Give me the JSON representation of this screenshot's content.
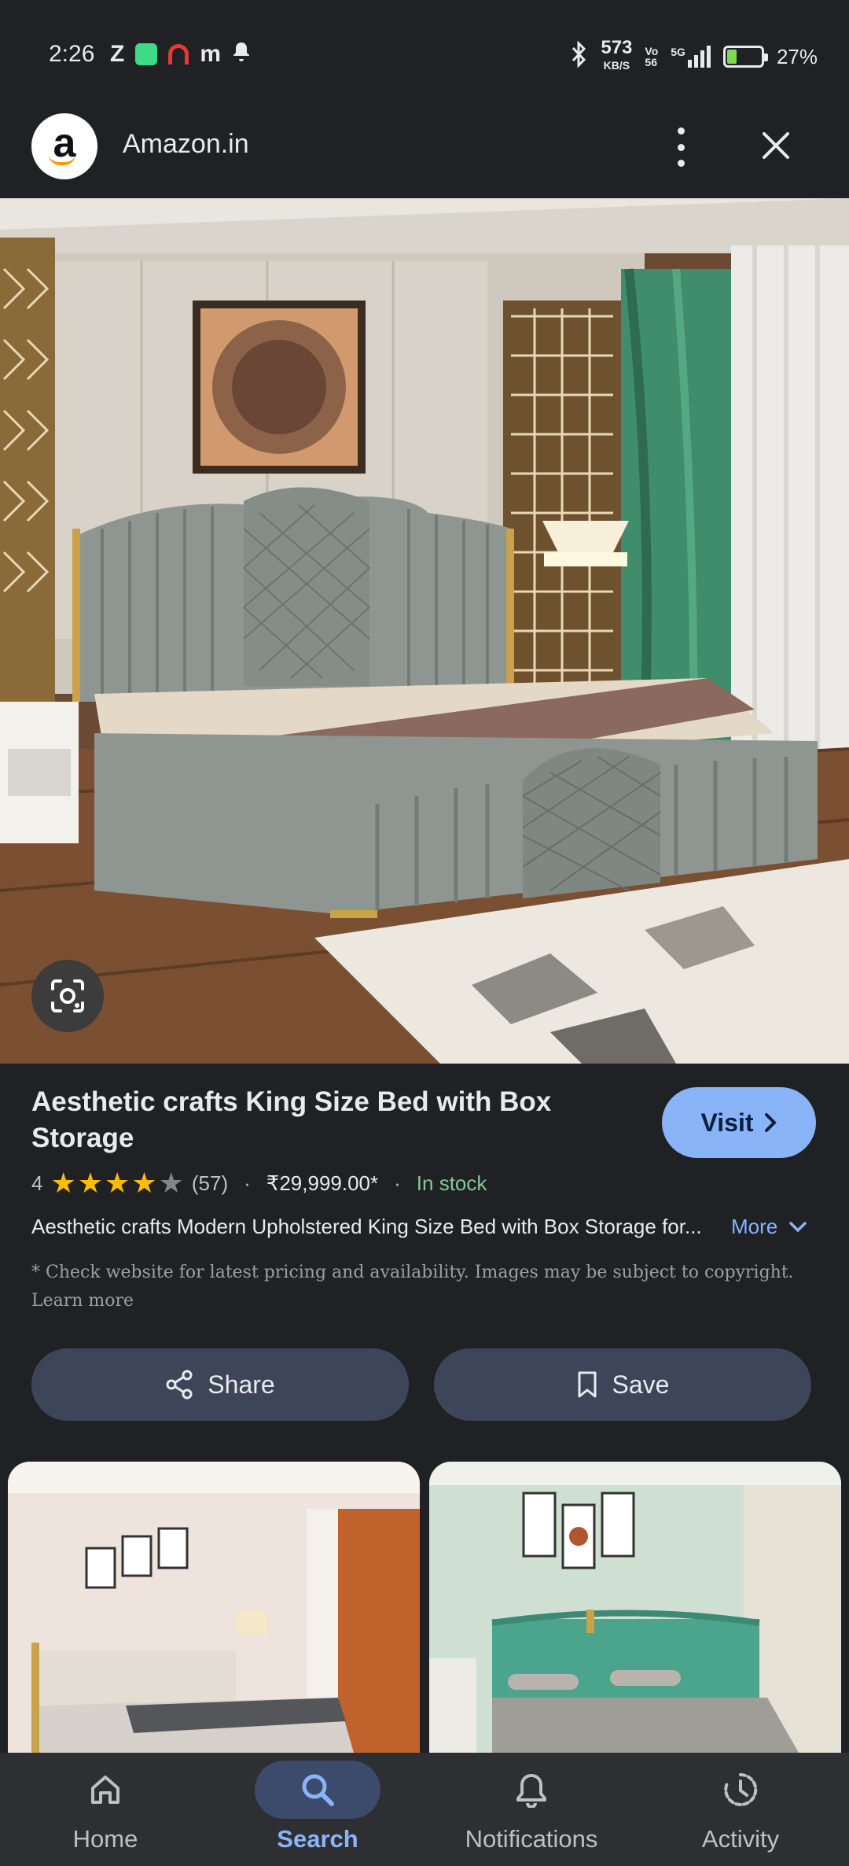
{
  "status_bar": {
    "time": "2:26",
    "left_glyphs": [
      "Z",
      "m"
    ],
    "net_speed": "573",
    "net_unit": "KB/S",
    "volte": "Vo",
    "volte_sub": "56",
    "signal": "5G",
    "battery_percent": "27%",
    "battery_level": 0.27,
    "icons": [
      "z-app-icon",
      "green-app-icon",
      "red-app-icon",
      "m-app-icon",
      "bell-icon",
      "bluetooth-icon",
      "signal-icon",
      "battery-icon"
    ]
  },
  "header": {
    "logo_letter": "a",
    "site_name": "Amazon.in",
    "icons": [
      "amazon-logo-icon",
      "more-vert-icon",
      "close-icon"
    ]
  },
  "product": {
    "title": "Aesthetic crafts King Size Bed with Box Storage",
    "visit_label": "Visit",
    "rating_value": "4",
    "rating_stars": 4,
    "rating_max": 5,
    "review_count": "(57)",
    "separator": "·",
    "price": "₹29,999.00*",
    "stock_status": "In stock",
    "description": "Aesthetic crafts Modern Upholstered King Size Bed with Box Storage for...",
    "more_label": "More",
    "disclaimer": "* Check website for latest pricing and availability. Images may be subject to copyright. Learn more"
  },
  "actions": {
    "share_label": "Share",
    "save_label": "Save"
  },
  "bottom_nav": {
    "items": [
      {
        "label": "Home",
        "icon": "home-icon"
      },
      {
        "label": "Search",
        "icon": "search-icon",
        "active": true
      },
      {
        "label": "Notifications",
        "icon": "bell-icon"
      },
      {
        "label": "Activity",
        "icon": "history-icon"
      }
    ]
  },
  "colors": {
    "background": "#202124",
    "accent": "#8ab4f8",
    "star": "#fbbc04",
    "in_stock": "#81c995",
    "button_bg": "#3c4658",
    "nav_bg": "#2d2f33"
  }
}
